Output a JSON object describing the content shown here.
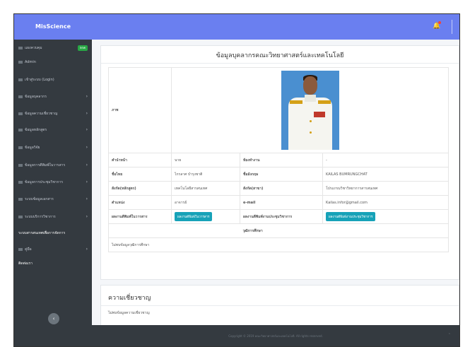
{
  "app": {
    "brand": "MisScience"
  },
  "sidebar": {
    "items": [
      {
        "label": "แผงควบคุม",
        "badge": "new"
      },
      {
        "label": "Admin"
      },
      {
        "label": "เข้าสู่ระบบ (Login)"
      },
      {
        "label": "ข้อมูลบุคลากร"
      },
      {
        "label": "ข้อมูลความเชี่ยวชาญ"
      },
      {
        "label": "ข้อมูลหลักสูตร"
      },
      {
        "label": "ข้อมูลวิจัย"
      },
      {
        "label": "ข้อมูลการตีพิมพ์ในวารสาร"
      },
      {
        "label": "ข้อมูลการประชุมวิชาการ"
      },
      {
        "label": "ระบบข้อมูลเอกสาร"
      },
      {
        "label": "ระบบบริการวิชาการ"
      }
    ],
    "header_1": "ระบบสารสนเทศเพื่อการจัดการ",
    "manual": "คู่มือ",
    "contact": "ติดต่อเรา",
    "circle_icon": "chevron-left"
  },
  "profile": {
    "title": "ข้อมูลบุคลากรคณะวิทยาศาสตร์และเทคโนโลยี",
    "photo_label": "ภาพ",
    "rows": [
      {
        "l1": "คำนำหน้า",
        "v1": "นาย",
        "l2": "ห้องทำงาน",
        "v2": "-"
      },
      {
        "l1": "ชื่อไทย",
        "v1": "ไกรลาศ บำรุงชาติ",
        "l2": "ชื่ออังกฤษ",
        "v2": "KAILAS BUMRUNGCHAT"
      },
      {
        "l1": "สังกัด(หลักสูตร)",
        "v1": "เทคโนโลยีสารสนเทศ",
        "l2": "สังกัด(สาขา)",
        "v2": "โปรแกรมวิชาวิทยาการสารสนเทศ"
      },
      {
        "l1": "ตำแหน่ง",
        "v1": "อาจารย์",
        "l2": "e-mail",
        "v2": "Kailas.infor@gmail.com"
      }
    ],
    "pub_label": "ผลงานตีพิมพ์ในวารสาร",
    "pub_button": "ผลงานตีพิมพ์ในวารสาร",
    "conf_label": "ผลงานตีพิมพ์งานประชุมวิชาการ",
    "conf_button": "ผลงานตีพิมพ์งานประชุมวิชาการ",
    "edu_label": "วุฒิการศึกษา",
    "edu_empty": "ไม่พบข้อมูลวุฒิการศึกษา"
  },
  "expertise": {
    "title": "ความเชี่ยวชาญ",
    "empty": "ไม่พบข้อมูลความเชี่ยวชาญ"
  },
  "footer": {
    "text": "Copyright © 2019 คณะวิทยาศาสตร์และเทคโนโลยี. All rights reserved."
  },
  "colors": {
    "topbar": "#6a7ff0",
    "sidebar": "#343a40",
    "button": "#17a2b8",
    "badge": "#28a745"
  }
}
